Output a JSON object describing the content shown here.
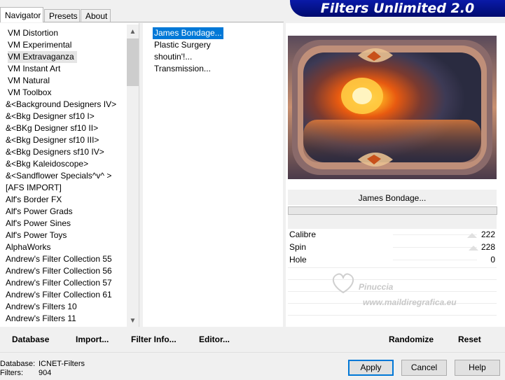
{
  "tabs": [
    {
      "label": "Navigator",
      "active": true
    },
    {
      "label": "Presets",
      "active": false
    },
    {
      "label": "About",
      "active": false
    }
  ],
  "banner_title": "Filters Unlimited 2.0",
  "categories": [
    "VM Distortion",
    "VM Experimental",
    "VM Extravaganza",
    "VM Instant Art",
    "VM Natural",
    "VM Toolbox",
    "&<Background Designers IV>",
    "&<Bkg Designer sf10 I>",
    "&<BKg Designer sf10 II>",
    "&<Bkg Designer sf10 III>",
    "&<Bkg Designers sf10 IV>",
    "&<Bkg Kaleidoscope>",
    "&<Sandflower Specials^v^ >",
    "[AFS IMPORT]",
    "Alf's Border FX",
    "Alf's Power Grads",
    "Alf's Power Sines",
    "Alf's Power Toys",
    "AlphaWorks",
    "Andrew's Filter Collection 55",
    "Andrew's Filter Collection 56",
    "Andrew's Filter Collection 57",
    "Andrew's Filter Collection 61",
    "Andrew's Filters 10",
    "Andrew's Filters 11"
  ],
  "selected_category_index": 2,
  "filters": [
    "James Bondage...",
    "Plastic Surgery",
    "shoutin'!...",
    "Transmission..."
  ],
  "selected_filter_index": 0,
  "current_filter_name": "James Bondage...",
  "params": [
    {
      "label": "Calibre",
      "value": "222"
    },
    {
      "label": "Spin",
      "value": "228"
    },
    {
      "label": "Hole",
      "value": "0"
    }
  ],
  "watermark": {
    "name": "Pinuccia",
    "url": "www.maildiregrafica.eu"
  },
  "actions": {
    "database": "Database",
    "import": "Import...",
    "filter_info": "Filter Info...",
    "editor": "Editor...",
    "randomize": "Randomize",
    "reset": "Reset"
  },
  "status": {
    "database_label": "Database:",
    "database_value": "ICNET-Filters",
    "filters_label": "Filters:",
    "filters_value": "904"
  },
  "buttons": {
    "apply": "Apply",
    "cancel": "Cancel",
    "help": "Help"
  },
  "icons": {
    "scroll_up": "▲",
    "scroll_down": "▼"
  },
  "colors": {
    "banner": "#0a1aa8",
    "selection": "#0078d7"
  }
}
